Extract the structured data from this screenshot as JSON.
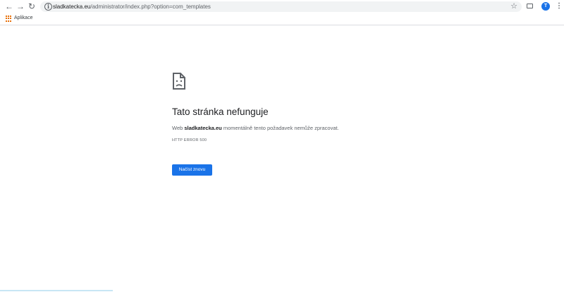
{
  "browser": {
    "address": {
      "host": "sladkatecka.eu",
      "path": "/administrator/index.php?option=com_templates"
    },
    "profile_initial": "T",
    "bookmarks": [
      {
        "label": "Aplikace",
        "icon": "apps-grid-icon"
      }
    ]
  },
  "error_page": {
    "icon": "sad-page-icon",
    "title": "Tato stránka nefunguje",
    "message_prefix": "Web ",
    "message_host": "sladkatecka.eu",
    "message_suffix": " momentálně tento požadavek nemůže zpracovat.",
    "error_code": "HTTP ERROR 500",
    "reload_label": "Načíst znovu"
  },
  "colors": {
    "accent": "#1a73e8",
    "apps_icon": "#e8710a"
  }
}
